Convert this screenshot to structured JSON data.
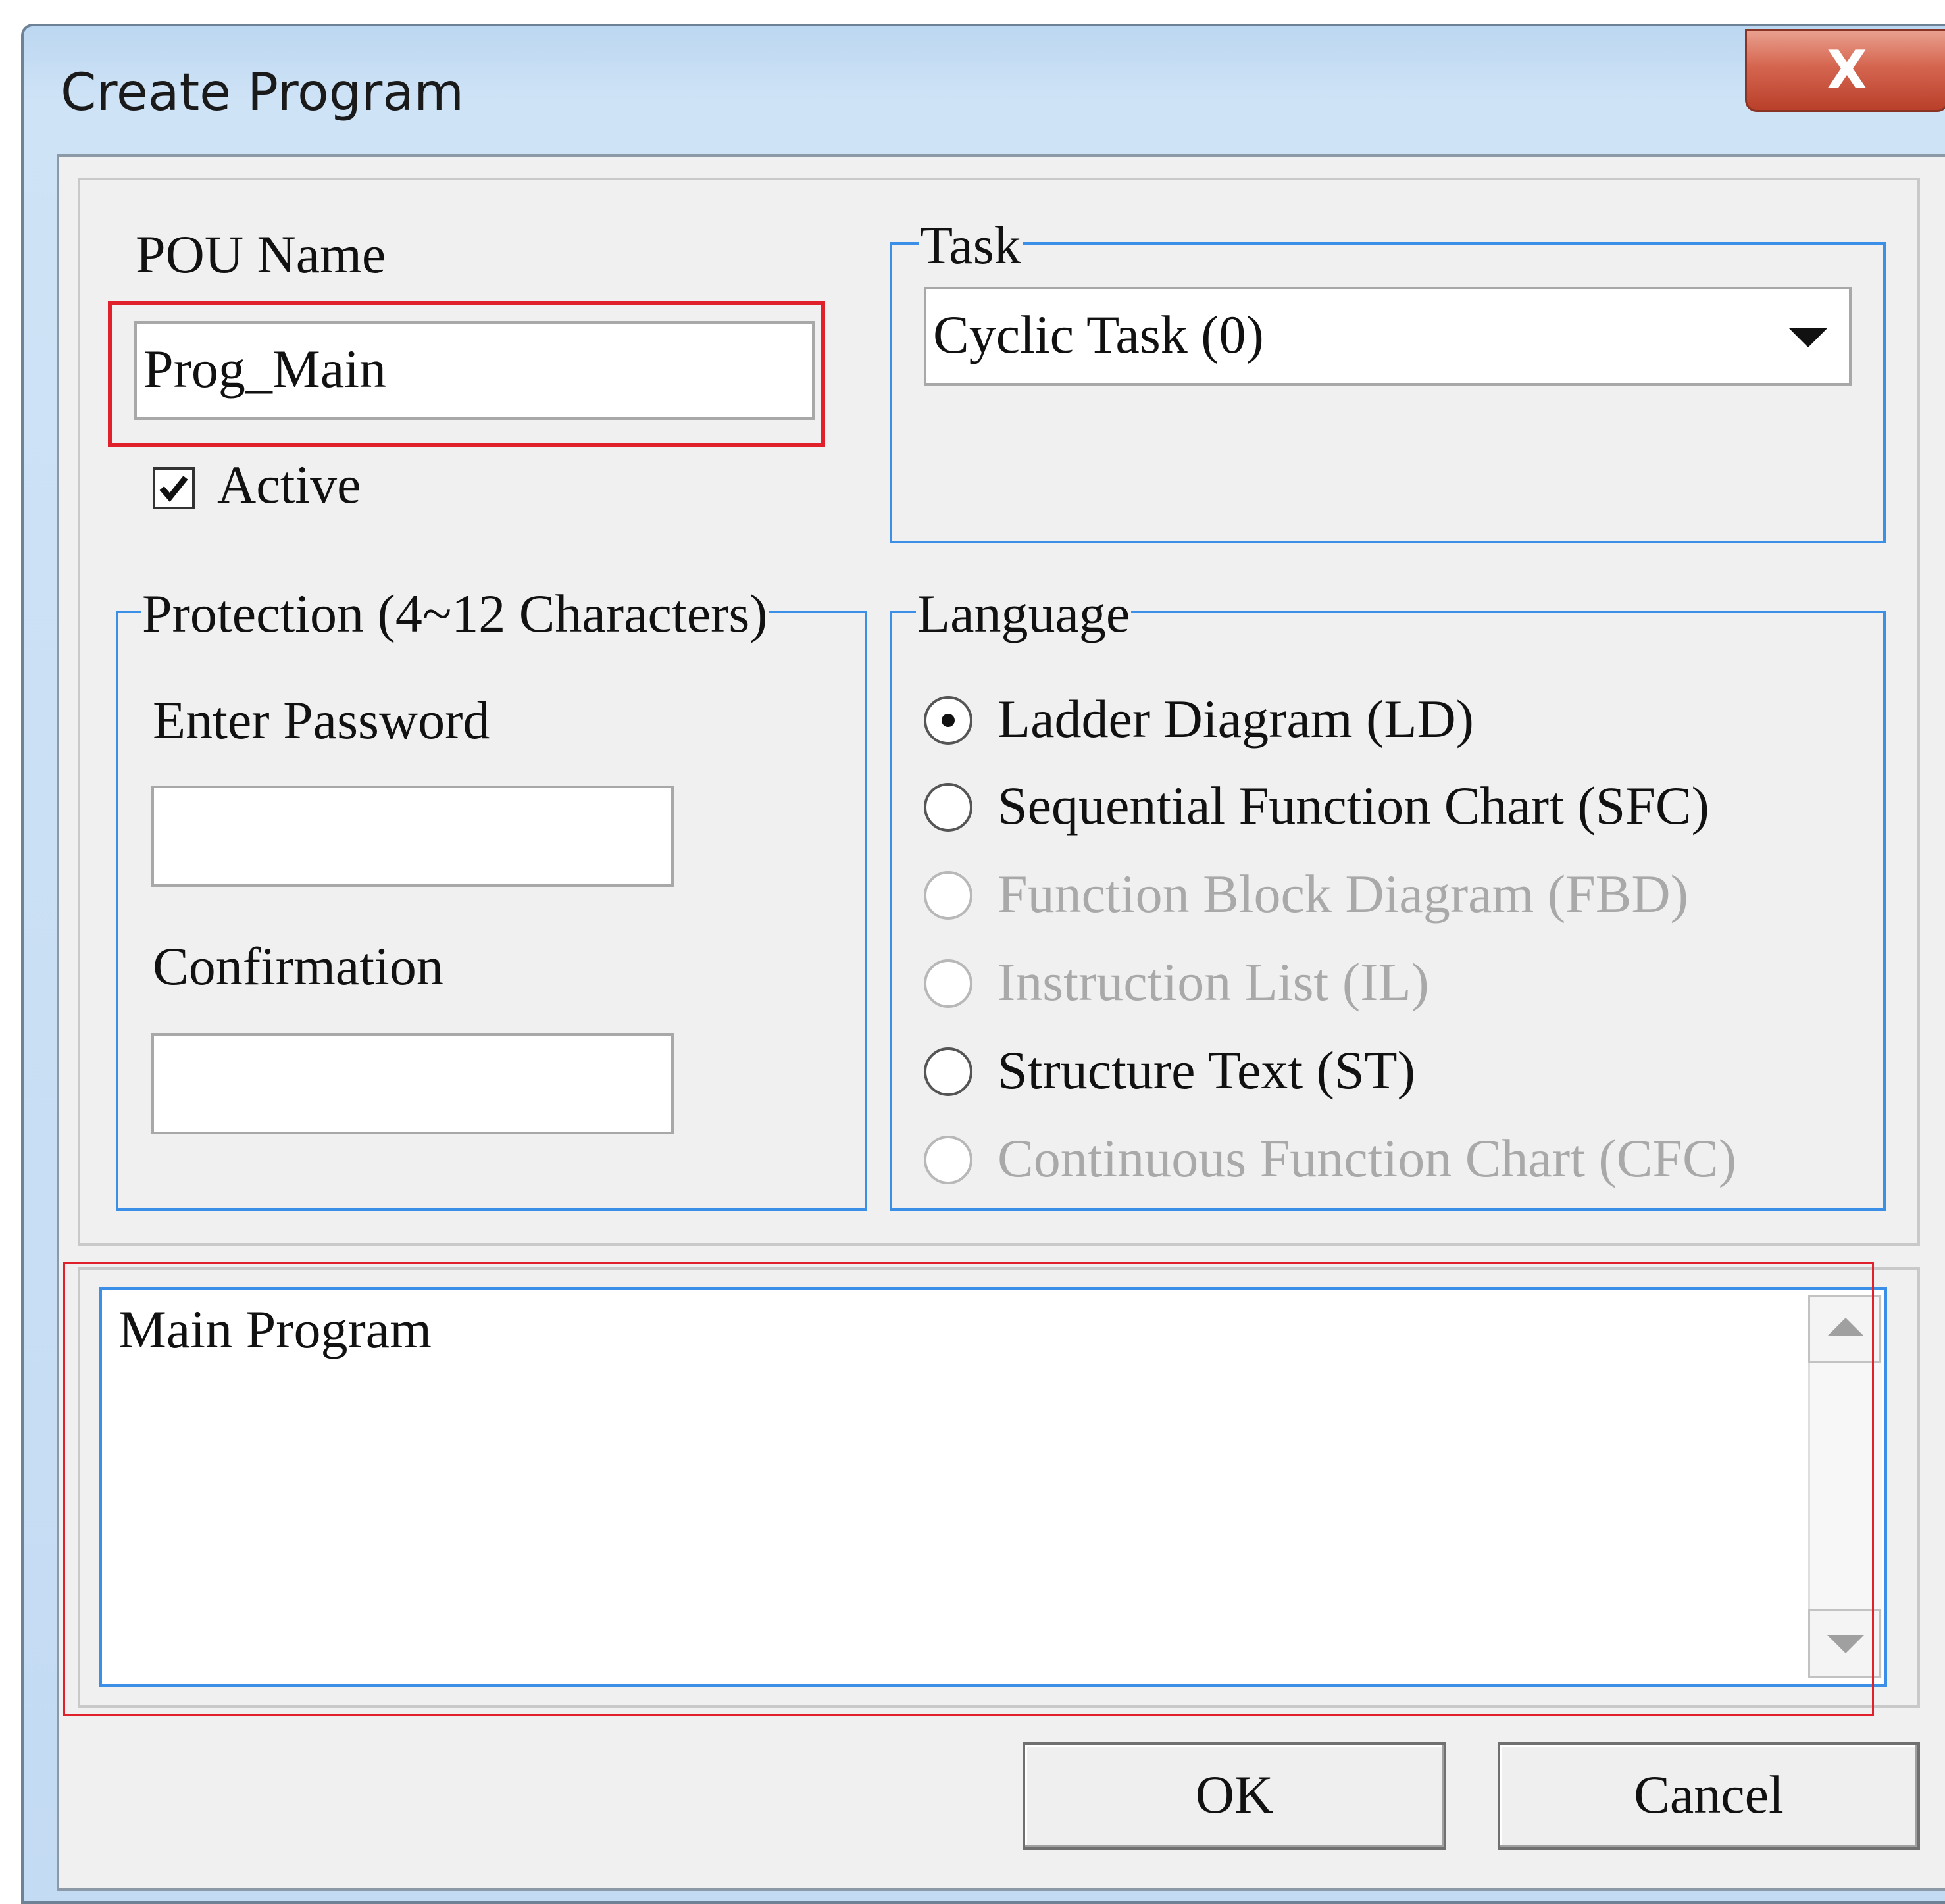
{
  "window": {
    "title": "Create Program",
    "close_label": "X"
  },
  "pou": {
    "label": "POU Name",
    "value": "Prog_Main",
    "active_label": "Active",
    "active_checked": true
  },
  "task": {
    "legend": "Task",
    "selected": "Cyclic Task (0)"
  },
  "protection": {
    "legend": "Protection (4~12 Characters)",
    "password_label": "Enter Password",
    "password_value": "",
    "confirmation_label": "Confirmation",
    "confirmation_value": ""
  },
  "language": {
    "legend": "Language",
    "options": [
      {
        "label": "Ladder Diagram (LD)",
        "selected": true,
        "enabled": true
      },
      {
        "label": "Sequential Function Chart (SFC)",
        "selected": false,
        "enabled": true
      },
      {
        "label": "Function Block Diagram (FBD)",
        "selected": false,
        "enabled": false
      },
      {
        "label": "Instruction List (IL)",
        "selected": false,
        "enabled": false
      },
      {
        "label": "Structure Text (ST)",
        "selected": false,
        "enabled": true
      },
      {
        "label": "Continuous Function Chart (CFC)",
        "selected": false,
        "enabled": false
      }
    ]
  },
  "description": {
    "text": "Main Program"
  },
  "buttons": {
    "ok": "OK",
    "cancel": "Cancel"
  },
  "colors": {
    "highlight": "#e0202a",
    "group_border": "#3c8fe6",
    "dialog_bg": "#f0f0f0"
  }
}
